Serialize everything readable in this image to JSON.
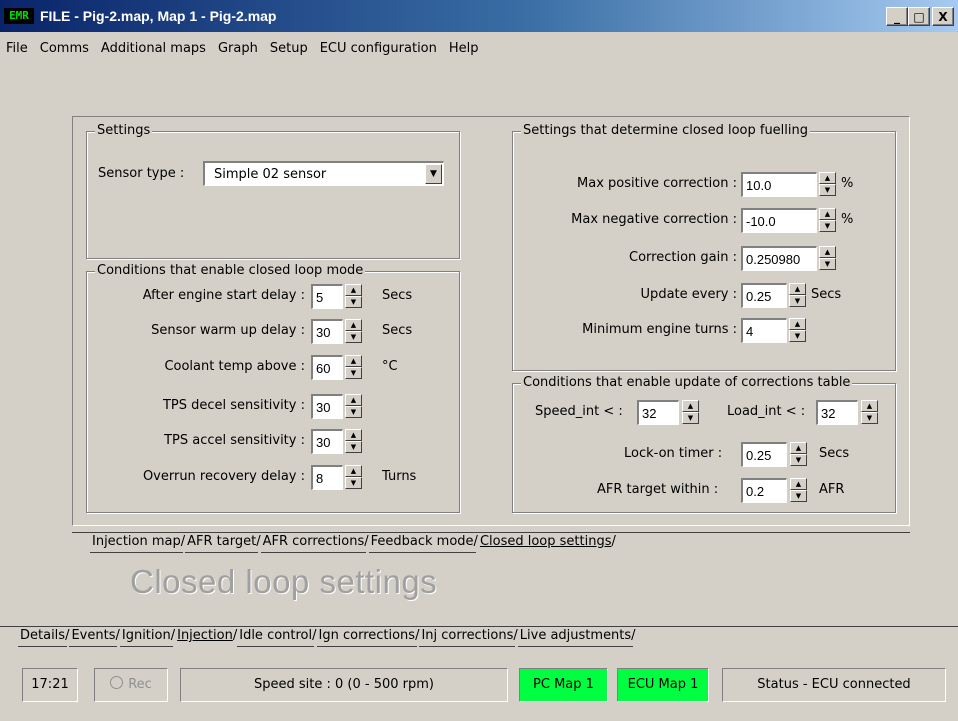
{
  "window": {
    "icon_text": "EMR",
    "title": "FILE - Pig-2.map,  Map 1 - Pig-2.map",
    "minimize": "_",
    "maximize": "□",
    "close": "X"
  },
  "menu": [
    "File",
    "Comms",
    "Additional maps",
    "Graph",
    "Setup",
    "ECU configuration",
    "Help"
  ],
  "settings": {
    "legend": "Settings",
    "sensor_type_label": "Sensor type :",
    "sensor_type_value": "Simple 02 sensor"
  },
  "conditions_enable": {
    "legend": "Conditions that enable closed loop mode",
    "rows": [
      {
        "label": "After engine start delay :",
        "value": "5",
        "unit": "Secs"
      },
      {
        "label": "Sensor warm up delay :",
        "value": "30",
        "unit": "Secs"
      },
      {
        "label": "Coolant temp above :",
        "value": "60",
        "unit": "°C"
      },
      {
        "label": "TPS decel sensitivity :",
        "value": "30",
        "unit": ""
      },
      {
        "label": "TPS accel sensitivity :",
        "value": "30",
        "unit": ""
      },
      {
        "label": "Overrun recovery delay :",
        "value": "8",
        "unit": "Turns"
      }
    ]
  },
  "closed_loop_fuelling": {
    "legend": "Settings that determine closed loop fuelling",
    "rows": [
      {
        "label": "Max positive correction :",
        "value": "10.0",
        "unit": "%"
      },
      {
        "label": "Max negative correction :",
        "value": "-10.0",
        "unit": "%"
      },
      {
        "label": "Correction gain :",
        "value": "0.250980",
        "unit": ""
      },
      {
        "label": "Update every :",
        "value": "0.25",
        "unit": "Secs"
      },
      {
        "label": "Minimum engine turns :",
        "value": "4",
        "unit": ""
      }
    ]
  },
  "corrections_update": {
    "legend": "Conditions that enable update of corrections table",
    "speed_label": "Speed_int < :",
    "speed_value": "32",
    "load_label": "Load_int < :",
    "load_value": "32",
    "lockon_label": "Lock-on timer :",
    "lockon_value": "0.25",
    "lockon_unit": "Secs",
    "afr_label": "AFR target within :",
    "afr_value": "0.2",
    "afr_unit": "AFR"
  },
  "map_tabs": [
    "Injection map",
    "AFR target",
    "AFR corrections",
    "Feedback mode",
    "Closed loop settings"
  ],
  "map_tabs_active": 4,
  "big_title": "Closed loop settings",
  "main_tabs": [
    "Details",
    "Events",
    "Ignition",
    "Injection",
    "Idle control",
    "Ign corrections",
    "Inj corrections",
    "Live adjustments"
  ],
  "main_tabs_active": 3,
  "status": {
    "time": "17:21",
    "rec": "Rec",
    "speed_site": "Speed site : 0 (0 - 500 rpm)",
    "pc_map": "PC Map 1",
    "ecu_map": "ECU Map 1",
    "status_text": "Status - ECU connected",
    "active_color": "#00ff40"
  }
}
